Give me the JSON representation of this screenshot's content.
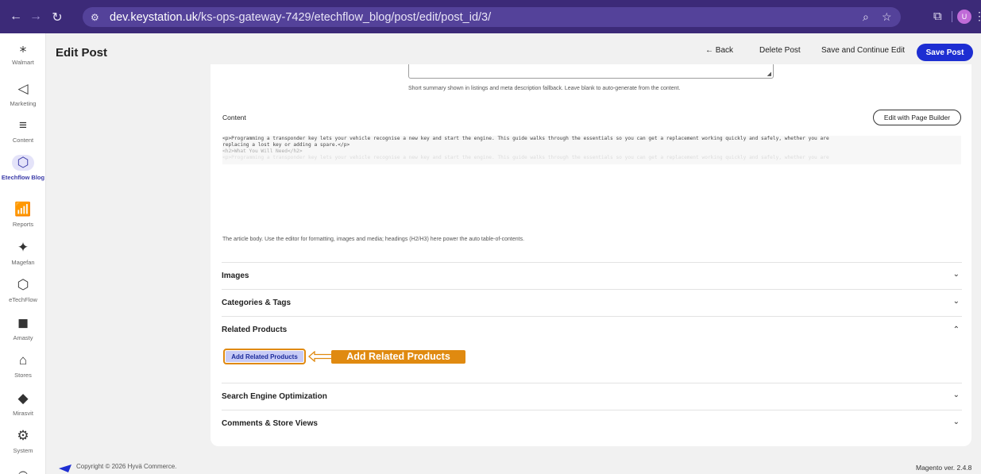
{
  "browser": {
    "back_icon": "back-arrow-icon",
    "forward_icon": "forward-arrow-icon",
    "reload_icon": "reload-icon",
    "url_domain": "dev.keystation.uk",
    "url_path": "/ks-ops-gateway-7429/etechflow_blog/post/edit/post_id/3/",
    "profile_initial": "U"
  },
  "sidebar": {
    "items": [
      {
        "label": "Walmart",
        "icon": "walmart-spark-icon"
      },
      {
        "label": "Marketing",
        "icon": "megaphone-icon"
      },
      {
        "label": "Content",
        "icon": "content-icon"
      },
      {
        "label": "Etechflow Blog",
        "icon": "cube-icon",
        "active": true
      },
      {
        "label": "Reports",
        "icon": "bar-chart-icon"
      },
      {
        "label": "Magefan",
        "icon": "magefan-icon"
      },
      {
        "label": "eTechFlow",
        "icon": "cube-icon"
      },
      {
        "label": "Amasty",
        "icon": "amasty-icon"
      },
      {
        "label": "Stores",
        "icon": "store-icon"
      },
      {
        "label": "Mirasvit",
        "icon": "diamond-icon"
      },
      {
        "label": "System",
        "icon": "gear-icon"
      }
    ]
  },
  "header": {
    "title": "Edit Post",
    "back_label": "← Back",
    "delete_label": "Delete Post",
    "save_continue_label": "Save and Continue Edit",
    "save_label": "Save Post"
  },
  "form": {
    "excerpt_hint": "Short summary shown in listings and meta description fallback. Leave blank to auto-generate from the content.",
    "content_label": "Content",
    "page_builder_label": "Edit with Page Builder",
    "content_code": [
      "<p>Programming a transponder key lets your vehicle recognise a new key and start the engine. This guide walks through the essentials so you can get a replacement working quickly and safely, whether you are",
      "replacing a lost key or adding a spare.</p>",
      "<h2>What You Will Need</h2>"
    ],
    "content_hint": "The article body. Use the editor for formatting, images and media; headings (H2/H3) here power the auto table-of-contents."
  },
  "sections": [
    {
      "title": "Images",
      "expanded": false
    },
    {
      "title": "Categories & Tags",
      "expanded": false
    },
    {
      "title": "Related Products",
      "expanded": true
    },
    {
      "title": "Search Engine Optimization",
      "expanded": false
    },
    {
      "title": "Comments & Store Views",
      "expanded": false
    }
  ],
  "related": {
    "add_button_label": "Add Related Products",
    "callout_label": "Add Related Products"
  },
  "footer": {
    "copyright": "Copyright © 2026 Hyvä Commerce.",
    "version": "Magento ver. 2.4.8"
  },
  "colors": {
    "browser_bar": "#3c2a78",
    "primary_button": "#1d2ed2",
    "callout": "#e08a10"
  }
}
